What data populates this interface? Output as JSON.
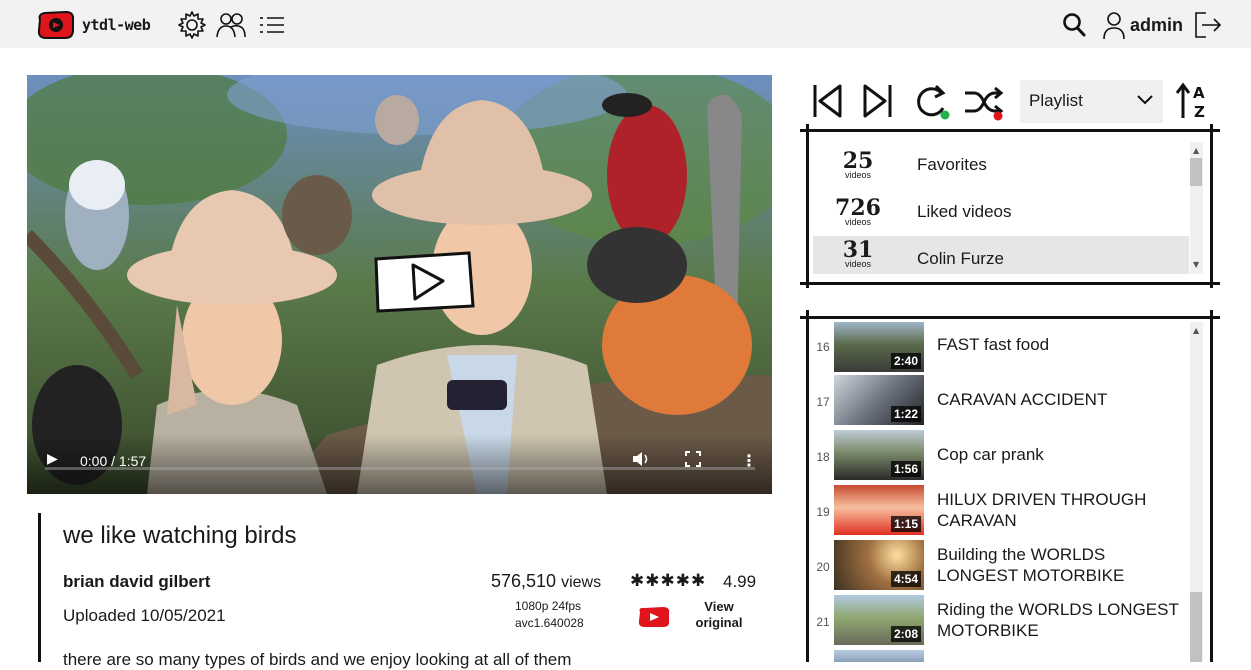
{
  "app": {
    "name": "ytdl-web"
  },
  "header": {
    "user_name": "admin"
  },
  "video": {
    "time_display": "0:00 / 1:57",
    "progress": 0.0
  },
  "info": {
    "title": "we like watching birds",
    "channel": "brian david gilbert",
    "uploaded": "Uploaded 10/05/2021",
    "views_number": "576,510",
    "views_unit": "views",
    "format_line1": "1080p 24fps",
    "format_line2": "avc1.640028",
    "stars_text": "✱✱✱✱✱",
    "rating": "4.99",
    "view_original_line1": "View",
    "view_original_line2": "original",
    "description": "there are so many types of birds and we enjoy looking at all of them"
  },
  "playlist_controls": {
    "selected": "Playlist"
  },
  "playlists": [
    {
      "count": "25",
      "unit": "videos",
      "name": "Favorites",
      "selected": false
    },
    {
      "count": "726",
      "unit": "videos",
      "name": "Liked videos",
      "selected": false
    },
    {
      "count": "31",
      "unit": "videos",
      "name": "Colin Furze",
      "selected": true
    }
  ],
  "queue": [
    {
      "index": "16",
      "duration": "2:40",
      "title": "FAST fast food"
    },
    {
      "index": "17",
      "duration": "1:22",
      "title": "CARAVAN ACCIDENT"
    },
    {
      "index": "18",
      "duration": "1:56",
      "title": "Cop car prank"
    },
    {
      "index": "19",
      "duration": "1:15",
      "title": "HILUX DRIVEN THROUGH CARAVAN"
    },
    {
      "index": "20",
      "duration": "4:54",
      "title": "Building the WORLDS LONGEST MOTORBIKE"
    },
    {
      "index": "21",
      "duration": "2:08",
      "title": "Riding the WORLDS LONGEST MOTORBIKE"
    }
  ],
  "colors": {
    "header_bg": "#f2f2f2",
    "brand_red": "#e0151b",
    "accent_green": "#22b14c",
    "accent_red": "#e0151b",
    "selected_row": "#e6e6e6"
  }
}
